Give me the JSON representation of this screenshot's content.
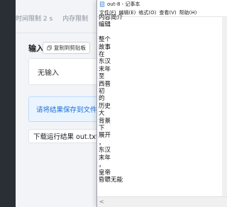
{
  "page": {
    "limits": [
      "时间限制 2 s",
      "内存限制"
    ],
    "input_title": "输入",
    "copy_button_label": "复制到剪贴板",
    "input_value": "无输入",
    "notice_text": "请将结果保存到文件: o",
    "download_text": "下载运行结果 out.txt"
  },
  "notepad": {
    "title": "out-8 - 记事本",
    "menu": [
      "文件(F)",
      "编辑(E)",
      "格式(O)",
      "查看(V)",
      "帮助(H)"
    ],
    "lines": [
      "内容简介",
      "编辑",
      "",
      "整个",
      "故事",
      "在",
      "东汉",
      "末年",
      "至",
      "西晋",
      "初",
      "的",
      "历史",
      "大",
      "背景",
      "下",
      "展开",
      "，",
      "东汉",
      "末年",
      "，",
      "皇帝",
      "昏聩无能"
    ]
  }
}
